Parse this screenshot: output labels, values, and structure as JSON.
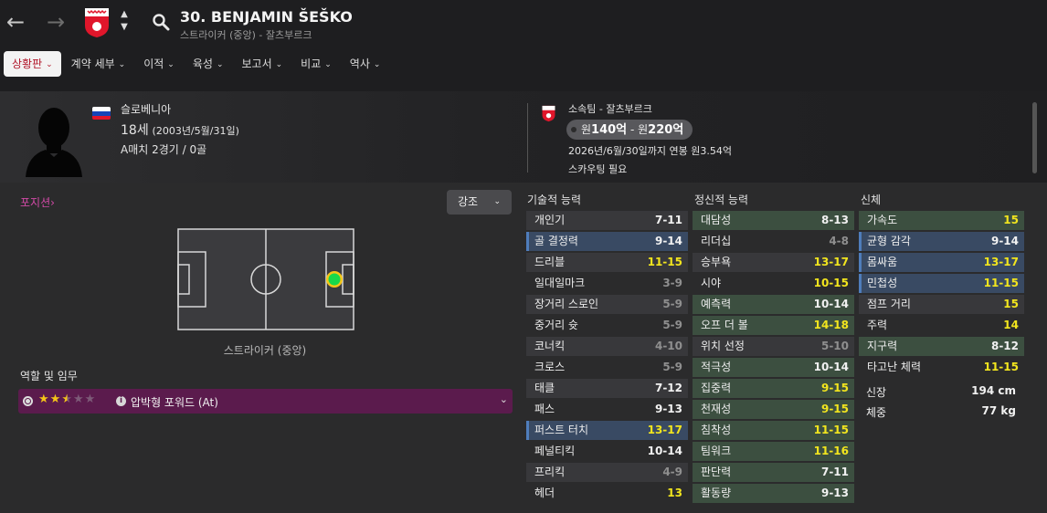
{
  "header": {
    "player_title": "30. BENJAMIN ŠEŠKO",
    "player_subtitle": "스트라이커 (중앙) - 잘츠부르크",
    "back_icon": "arrow-left-icon",
    "forward_icon": "arrow-right-icon",
    "club_colors": {
      "primary": "#e0162b",
      "secondary": "#ffffff"
    }
  },
  "tabs": [
    {
      "label": "상황판",
      "active": true
    },
    {
      "label": "계약 세부",
      "active": false
    },
    {
      "label": "이적",
      "active": false
    },
    {
      "label": "육성",
      "active": false
    },
    {
      "label": "보고서",
      "active": false
    },
    {
      "label": "비교",
      "active": false
    },
    {
      "label": "역사",
      "active": false
    }
  ],
  "profile": {
    "nationality": "슬로베니아",
    "age": "18세",
    "birth": "(2003년/5월/31일)",
    "caps": "A매치 2경기 / 0골",
    "club_line": "소속팀 - 잘츠부르크",
    "value_prefix_1": "원",
    "value_low": "140억",
    "value_sep": " - 원",
    "value_high": "220억",
    "contract": "2026년/6월/30일까지 연봉 원3.54억",
    "scouting": "스카우팅 필요"
  },
  "position_panel": {
    "link": "포지션",
    "highlight_label": "강조",
    "position_caption": "스트라이커 (중앙)",
    "pitch_colors": {
      "pitch": "#3b3b3e",
      "marker": "#18d84a",
      "ring": "#f5c518"
    }
  },
  "role": {
    "section_label": "역할 및 임무",
    "stars_on": "★★",
    "stars_half": "★",
    "stars_off": "★★",
    "star_rating": 2.5,
    "role_name": "압박형 포워드 (At)",
    "bar_color": "#5b1b4d"
  },
  "technical": {
    "heading": "기술적 능력",
    "rows": [
      {
        "name": "개인기",
        "value": "7-11"
      },
      {
        "name": "골 결정력",
        "value": "9-14"
      },
      {
        "name": "드리블",
        "value": "11-15"
      },
      {
        "name": "일대일마크",
        "value": "3-9"
      },
      {
        "name": "장거리 스로인",
        "value": "5-9"
      },
      {
        "name": "중거리 슛",
        "value": "5-9"
      },
      {
        "name": "코너킥",
        "value": "4-10"
      },
      {
        "name": "크로스",
        "value": "5-9"
      },
      {
        "name": "태클",
        "value": "7-12"
      },
      {
        "name": "패스",
        "value": "9-13"
      },
      {
        "name": "퍼스트 터치",
        "value": "13-17"
      },
      {
        "name": "페널티킥",
        "value": "10-14"
      },
      {
        "name": "프리킥",
        "value": "4-9"
      },
      {
        "name": "헤더",
        "value": "13"
      }
    ]
  },
  "mental": {
    "heading": "정신적 능력",
    "rows": [
      {
        "name": "대담성",
        "value": "8-13"
      },
      {
        "name": "리더십",
        "value": "4-8"
      },
      {
        "name": "승부욕",
        "value": "13-17"
      },
      {
        "name": "시야",
        "value": "10-15"
      },
      {
        "name": "예측력",
        "value": "10-14"
      },
      {
        "name": "오프 더 볼",
        "value": "14-18"
      },
      {
        "name": "위치 선정",
        "value": "5-10"
      },
      {
        "name": "적극성",
        "value": "10-14"
      },
      {
        "name": "집중력",
        "value": "9-15"
      },
      {
        "name": "천재성",
        "value": "9-15"
      },
      {
        "name": "침착성",
        "value": "11-15"
      },
      {
        "name": "팀워크",
        "value": "11-16"
      },
      {
        "name": "판단력",
        "value": "7-11"
      },
      {
        "name": "활동량",
        "value": "9-13"
      }
    ]
  },
  "physical": {
    "heading": "신체",
    "rows": [
      {
        "name": "가속도",
        "value": "15"
      },
      {
        "name": "균형 감각",
        "value": "9-14"
      },
      {
        "name": "몸싸움",
        "value": "13-17"
      },
      {
        "name": "민첩성",
        "value": "11-15"
      },
      {
        "name": "점프 거리",
        "value": "15"
      },
      {
        "name": "주력",
        "value": "14"
      },
      {
        "name": "지구력",
        "value": "8-12"
      },
      {
        "name": "타고난 체력",
        "value": "11-15"
      }
    ],
    "height_label": "신장",
    "height_value": "194 cm",
    "weight_label": "체중",
    "weight_value": "77 kg"
  }
}
